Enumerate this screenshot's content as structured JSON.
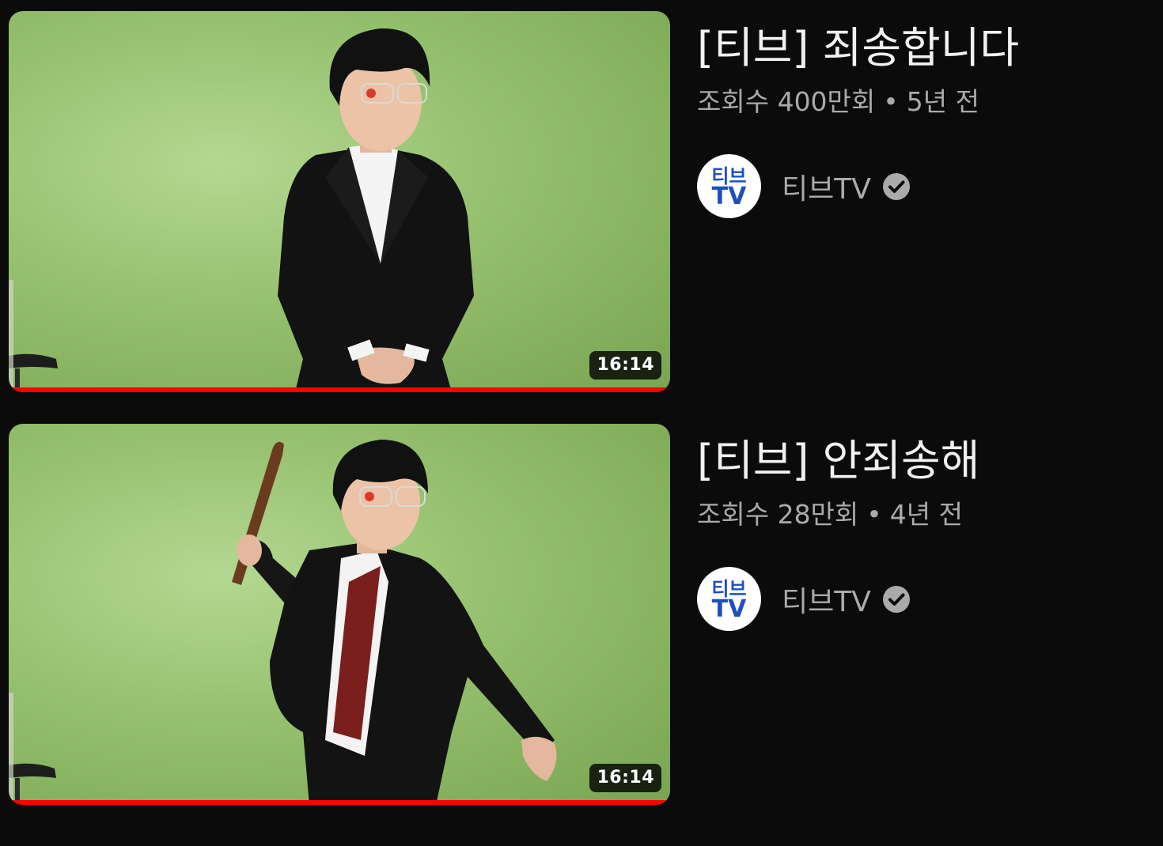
{
  "videos": [
    {
      "title": "[티브] 죄송합니다",
      "views": "조회수 400만회",
      "separator": "•",
      "age": "5년 전",
      "channel": "티브TV",
      "avatar_line1": "티브",
      "avatar_line2": "TV",
      "duration": "16:14",
      "watched_progress": 1.0,
      "verified_icon": "verified-check-icon"
    },
    {
      "title": "[티브] 안죄송해",
      "views": "조회수 28만회",
      "separator": "•",
      "age": "4년 전",
      "channel": "티브TV",
      "avatar_line1": "티브",
      "avatar_line2": "TV",
      "duration": "16:14",
      "watched_progress": 1.0,
      "verified_icon": "verified-check-icon"
    }
  ],
  "colors": {
    "background": "#0b0b0b",
    "progress": "#ff0000",
    "title": "#f1f1f1",
    "secondary": "#aaaaaa",
    "avatar_text": "#1f4fbf"
  }
}
